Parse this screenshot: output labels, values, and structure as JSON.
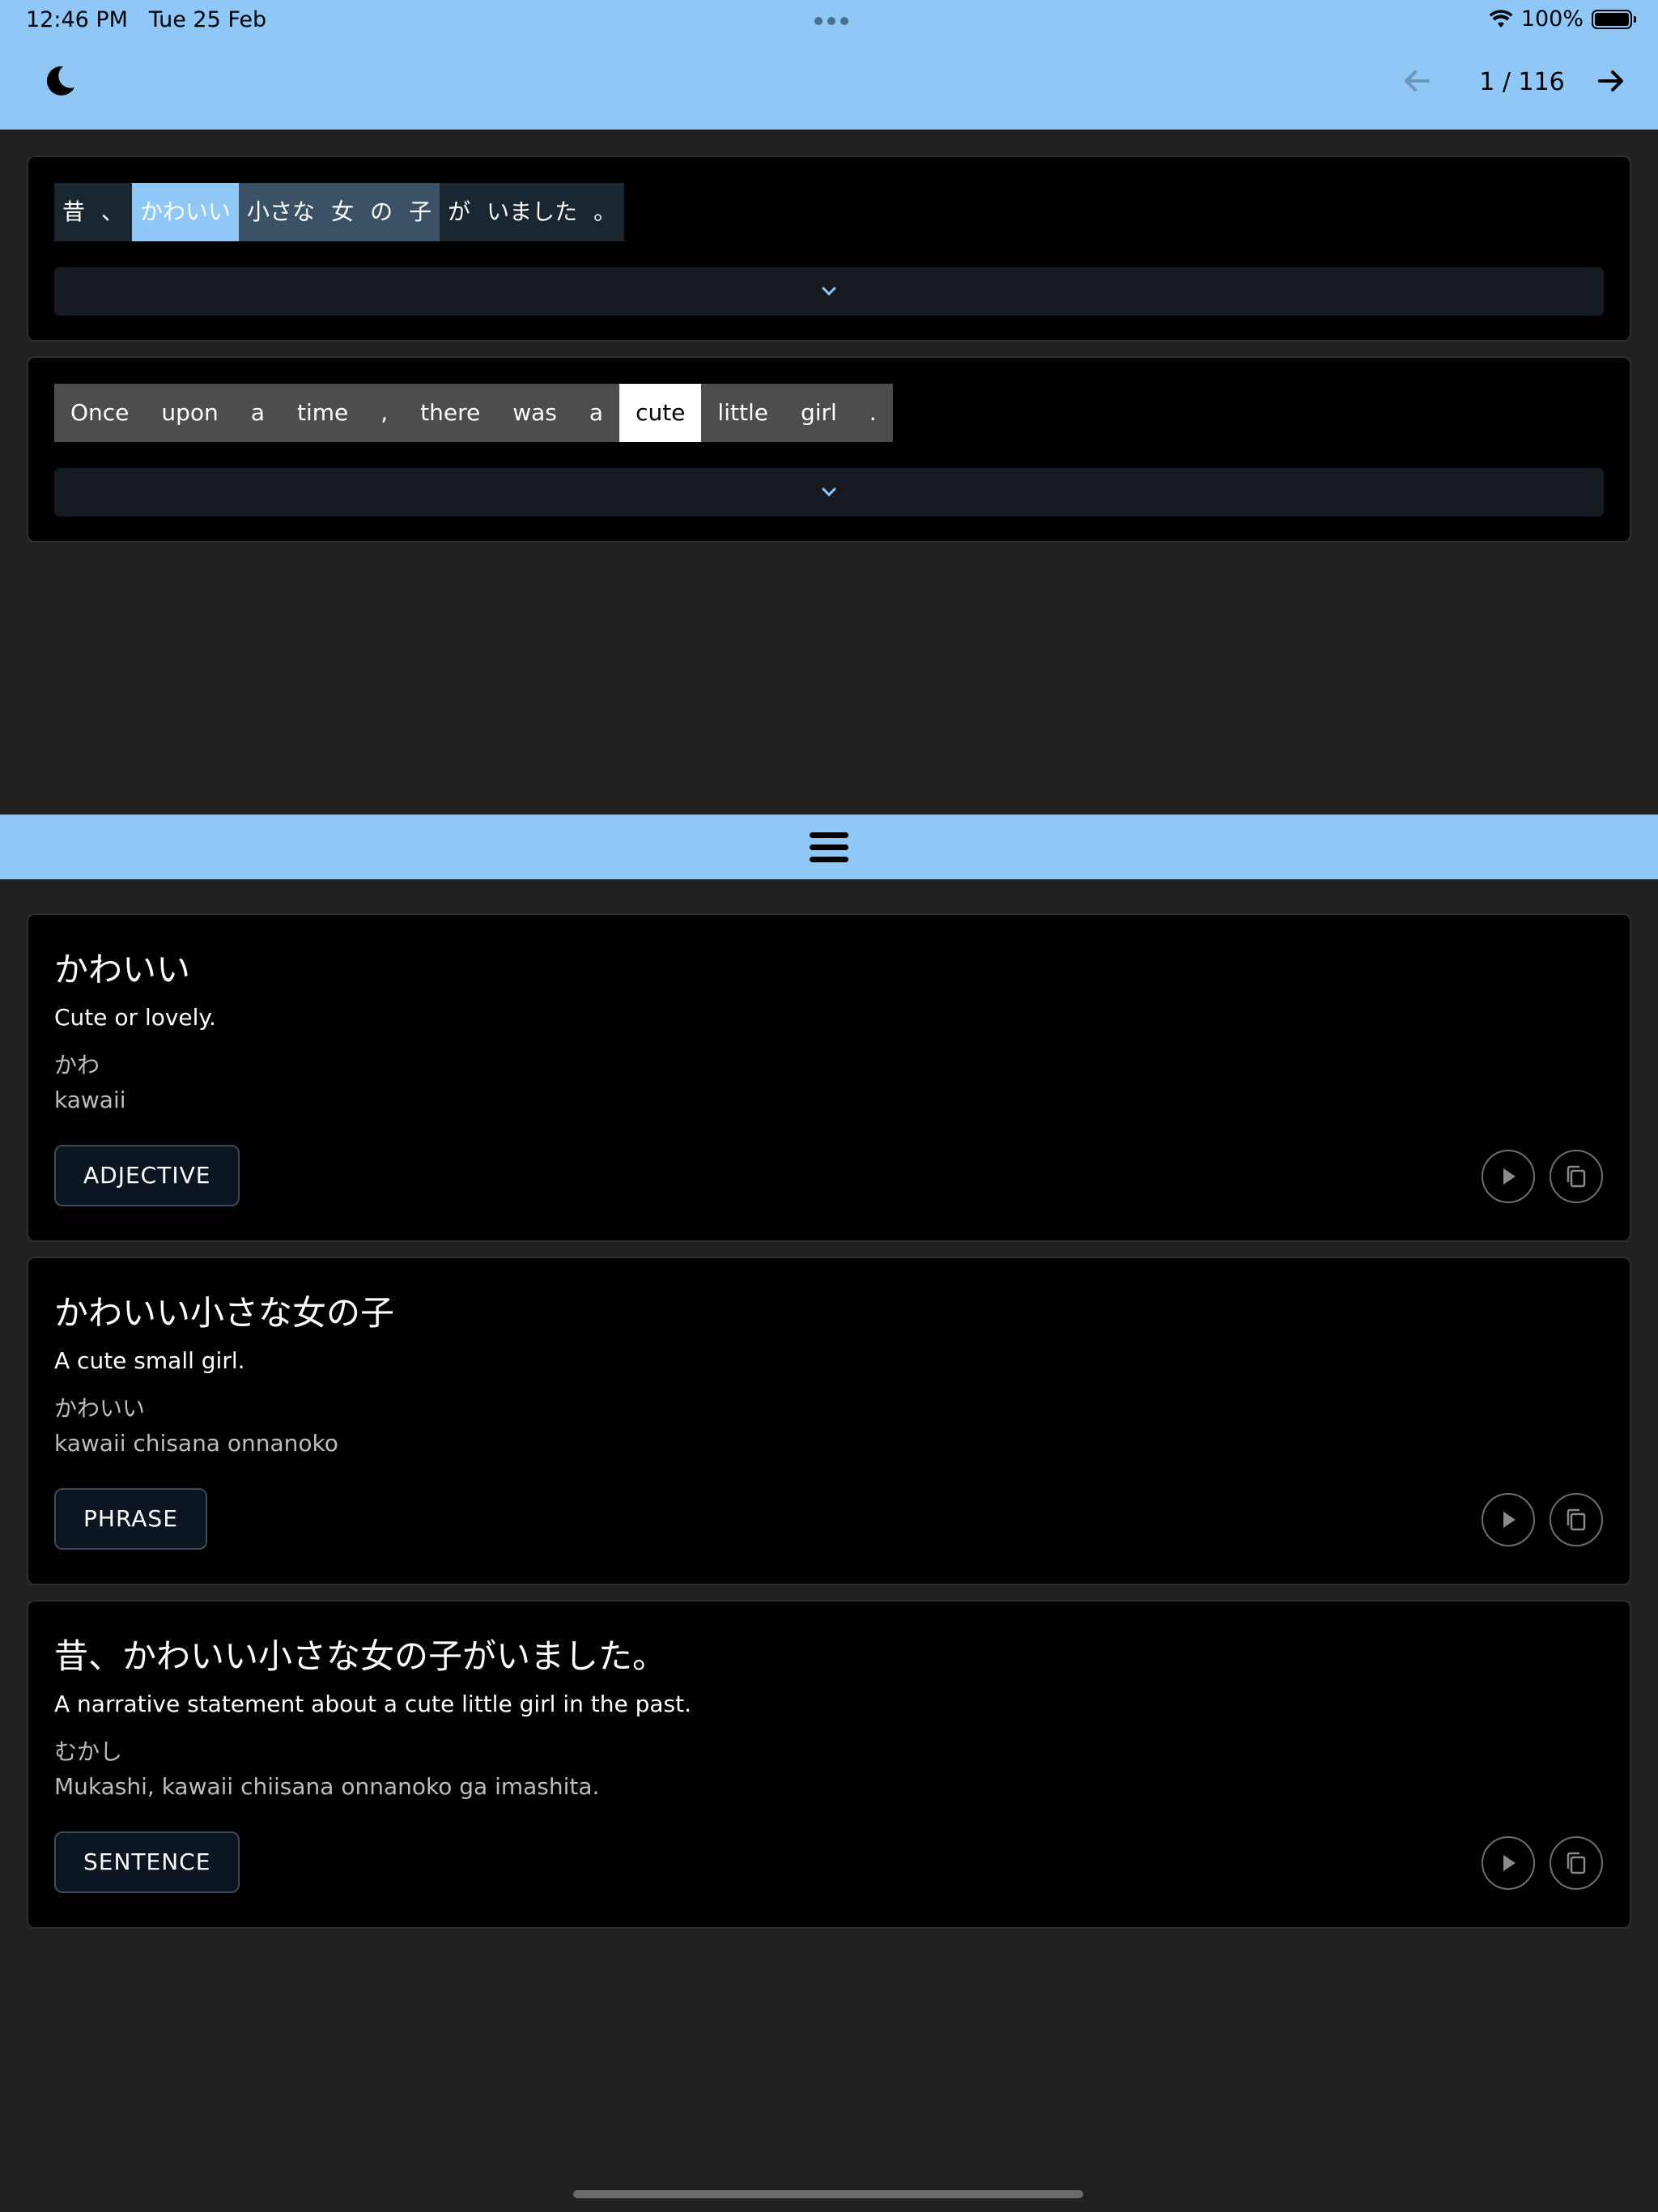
{
  "status_bar": {
    "time": "12:46 PM",
    "date": "Tue 25 Feb",
    "battery": "100%"
  },
  "nav": {
    "page_counter": "1 / 116"
  },
  "japanese_tokens": [
    {
      "text": "昔",
      "state": "normal"
    },
    {
      "text": "、",
      "state": "normal"
    },
    {
      "text": "かわいい",
      "state": "selected"
    },
    {
      "text": "小さな",
      "state": "group"
    },
    {
      "text": "女",
      "state": "group"
    },
    {
      "text": "の",
      "state": "group"
    },
    {
      "text": "子",
      "state": "group"
    },
    {
      "text": "が",
      "state": "normal"
    },
    {
      "text": "いました",
      "state": "normal"
    },
    {
      "text": "。",
      "state": "normal"
    }
  ],
  "english_tokens": [
    {
      "text": "Once",
      "state": "normal"
    },
    {
      "text": "upon",
      "state": "normal"
    },
    {
      "text": "a",
      "state": "normal"
    },
    {
      "text": "time",
      "state": "normal"
    },
    {
      "text": ",",
      "state": "normal"
    },
    {
      "text": "there",
      "state": "normal"
    },
    {
      "text": "was",
      "state": "normal"
    },
    {
      "text": "a",
      "state": "normal"
    },
    {
      "text": "cute",
      "state": "selected"
    },
    {
      "text": "little",
      "state": "normal"
    },
    {
      "text": "girl",
      "state": "normal"
    },
    {
      "text": ".",
      "state": "normal"
    }
  ],
  "definitions": [
    {
      "title": "かわいい",
      "meaning": "Cute or lovely.",
      "kana": "かわ",
      "romaji": "kawaii",
      "pos": "ADJECTIVE"
    },
    {
      "title": "かわいい小さな女の子",
      "meaning": "A cute small girl.",
      "kana": "かわいい",
      "romaji": "kawaii chisana onnanoko",
      "pos": "PHRASE"
    },
    {
      "title": "昔、かわいい小さな女の子がいました。",
      "meaning": "A narrative statement about a cute little girl in the past.",
      "kana": "むかし",
      "romaji": "Mukashi, kawaii chiisana onnanoko ga imashita.",
      "pos": "SENTENCE"
    }
  ],
  "colors": {
    "accent": "#8fc8f7",
    "background": "#212121",
    "card": "#000000",
    "selected_en": "#ffffff"
  },
  "icons": {
    "theme": "moon-icon",
    "prev": "arrow-left-icon",
    "next": "arrow-right-icon",
    "expand": "chevron-down-icon",
    "menu": "hamburger-icon",
    "play": "play-icon",
    "copy": "copy-icon"
  }
}
